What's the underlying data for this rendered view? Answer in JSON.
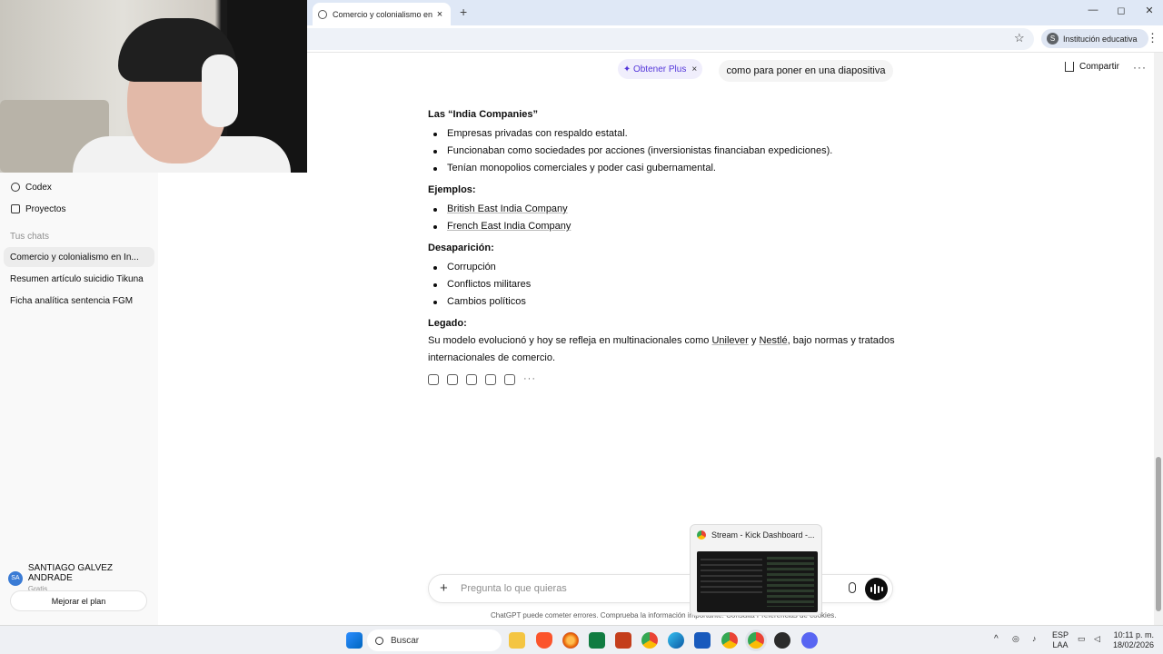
{
  "browser": {
    "tab_title": "Comercio y colonialismo en India",
    "tab_close": "×",
    "new_tab": "+",
    "profile_initial": "S",
    "profile_label": "Institución educativa",
    "star_icon": "☆",
    "menu_icon": "⋮",
    "win_min": "—",
    "win_max": "◻",
    "win_close": "✕"
  },
  "sidebar": {
    "items": [
      {
        "label": "Codex",
        "icon": "codex-icon"
      },
      {
        "label": "Proyectos",
        "icon": "folder-icon"
      }
    ],
    "section_label": "Tus chats",
    "chats": [
      {
        "label": "Comercio y colonialismo en In..."
      },
      {
        "label": "Resumen artículo suicidio Tikuna"
      },
      {
        "label": "Ficha analítica sentencia FGM"
      }
    ],
    "user_initials": "SA",
    "user_name": "SANTIAGO GALVEZ ANDRADE",
    "user_plan": "Gratis",
    "upgrade_label": "Mejorar el plan"
  },
  "header": {
    "plus_label": "✦ Obtener Plus",
    "plus_close": "×",
    "user_message": "como para poner en una diapositiva",
    "share_label": "Compartir",
    "more": "···"
  },
  "response": {
    "h1": "Las “India Companies”",
    "list1": [
      "Empresas privadas con respaldo estatal.",
      "Funcionaban como sociedades por acciones (inversionistas financiaban expediciones).",
      "Tenían monopolios comerciales y poder casi gubernamental."
    ],
    "h2": "Ejemplos:",
    "list2": [
      "British East India Company",
      "French East India Company"
    ],
    "h3": "Desaparición:",
    "list3": [
      "Corrupción",
      "Conflictos militares",
      "Cambios políticos"
    ],
    "h4": "Legado:",
    "legacy_a": "Su modelo evolucionó y hoy se refleja en multinacionales como ",
    "legacy_link1": "Unilever",
    "legacy_b": " y ",
    "legacy_link2": "Nestlé",
    "legacy_c": ", bajo normas y tratados internacionales de comercio."
  },
  "composer": {
    "plus": "+",
    "placeholder": "Pregunta lo que quieras",
    "disclaimer": "ChatGPT puede cometer errores. Comprueba la información importante. Consulta Preferencias de cookies."
  },
  "thumbnail": {
    "title": "Stream - Kick Dashboard -..."
  },
  "taskbar": {
    "search_label": "Buscar",
    "lang_top": "ESP",
    "lang_bottom": "LAA",
    "time": "10:11 p. m.",
    "date": "18/02/2026"
  },
  "colors": {
    "accent_plus": "#5436da",
    "sidebar_bg": "#f9f9f9"
  }
}
